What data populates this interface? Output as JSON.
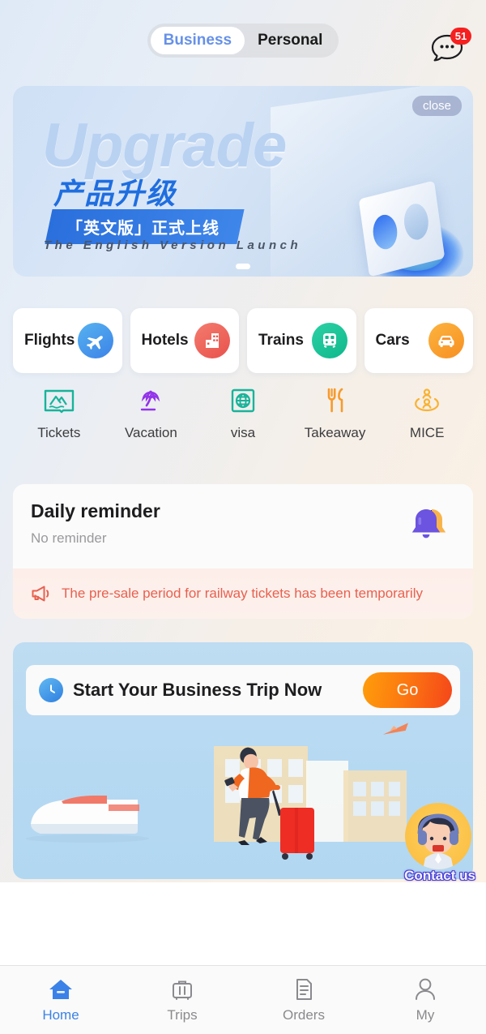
{
  "header": {
    "segments": [
      {
        "label": "Business",
        "active": true
      },
      {
        "label": "Personal",
        "active": false
      }
    ],
    "chat_icon": "chat-bubble-icon",
    "chat_badge": "51"
  },
  "banner": {
    "close_label": "close",
    "headline_en": "Upgrade",
    "headline_cn": "产品升级",
    "ribbon": "「英文版」正式上线",
    "subtitle": "The English Version Launch",
    "pagination": {
      "total": 1,
      "current": 1
    }
  },
  "services": [
    {
      "label": "Flights",
      "icon": "airplane-icon",
      "color": "#3b82e8"
    },
    {
      "label": "Hotels",
      "icon": "hotel-building-icon",
      "color": "#e8524c"
    },
    {
      "label": "Trains",
      "icon": "train-icon",
      "color": "#0fb88c"
    },
    {
      "label": "Cars",
      "icon": "car-icon",
      "color": "#f79022"
    }
  ],
  "quick_links": [
    {
      "label": "Tickets",
      "icon": "scenic-ticket-icon",
      "color": "#19b39a"
    },
    {
      "label": "Vacation",
      "icon": "palm-tree-icon",
      "color": "#9333ea"
    },
    {
      "label": "visa",
      "icon": "globe-passport-icon",
      "color": "#19b39a"
    },
    {
      "label": "Takeaway",
      "icon": "fork-knife-icon",
      "color": "#f79a2b"
    },
    {
      "label": "MICE",
      "icon": "meeting-people-icon",
      "color": "#f9b233"
    }
  ],
  "reminder": {
    "title": "Daily reminder",
    "subtitle": "No reminder",
    "icon": "bell-icon"
  },
  "notice": {
    "icon": "megaphone-icon",
    "text": "The pre-sale period for railway tickets has been temporarily",
    "color": "#e8604f"
  },
  "promo": {
    "icon": "clock-icon",
    "text": "Start Your Business Trip Now",
    "button_label": "Go",
    "illustration": "business-traveler-illustration"
  },
  "contact": {
    "label": "Contact us",
    "icon": "customer-service-agent-icon"
  },
  "tabbar": [
    {
      "label": "Home",
      "icon": "home-icon",
      "active": true
    },
    {
      "label": "Trips",
      "icon": "suitcase-icon",
      "active": false
    },
    {
      "label": "Orders",
      "icon": "document-icon",
      "active": false
    },
    {
      "label": "My",
      "icon": "person-icon",
      "active": false
    }
  ]
}
